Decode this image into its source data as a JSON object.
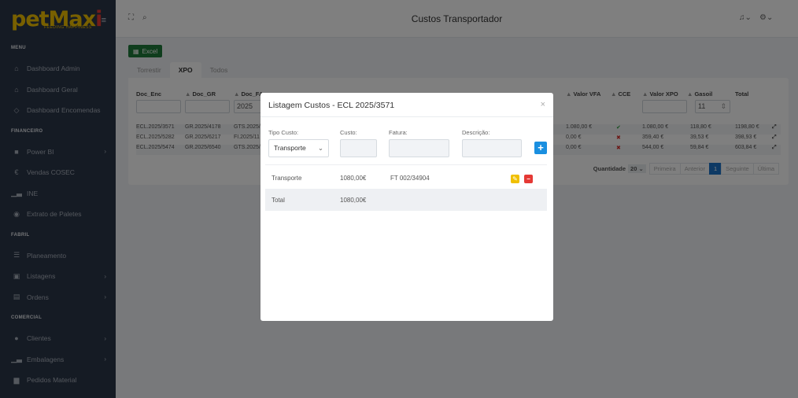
{
  "app": {
    "brand_main": "petMax",
    "brand_i": "i",
    "brand_tagline": "FEEDING HAPPINESS",
    "title": "Custos Transportador"
  },
  "sidebar": {
    "sections": [
      {
        "label": "MENU"
      },
      {
        "label": "FINANCEIRO"
      },
      {
        "label": "FABRIL"
      },
      {
        "label": "COMERCIAL"
      }
    ],
    "items": [
      {
        "label": "Dashboard Admin",
        "icon": "home-icon"
      },
      {
        "label": "Dashboard Geral",
        "icon": "home-icon"
      },
      {
        "label": "Dashboard Encomendas",
        "icon": "shield-icon"
      },
      {
        "label": "Power BI",
        "icon": "car-icon"
      },
      {
        "label": "Vendas COSEC",
        "icon": "euro-icon"
      },
      {
        "label": "INE",
        "icon": "chart-icon"
      },
      {
        "label": "Extrato de Paletes",
        "icon": "eye-icon"
      },
      {
        "label": "Planeamento",
        "icon": "list-icon"
      },
      {
        "label": "Listagens",
        "icon": "box-icon"
      },
      {
        "label": "Ordens",
        "icon": "file-icon"
      },
      {
        "label": "Clientes",
        "icon": "user-icon"
      },
      {
        "label": "Embalagens",
        "icon": "chart-icon"
      },
      {
        "label": "Pedidos Material",
        "icon": "truck-icon"
      }
    ]
  },
  "toolbar": {
    "excel_label": "Excel"
  },
  "tabs": [
    "Torrestir",
    "XPO",
    "Todos"
  ],
  "table": {
    "headers": [
      "Doc_Enc",
      "Doc_GR",
      "Doc_FA",
      "Valor VFA",
      "CCE",
      "Valor XPO",
      "Gasoil",
      "Total"
    ],
    "filter_year": "2025",
    "filter_gasoil": "11",
    "rows": [
      {
        "enc": "ECL.2025/3571",
        "gr": "GR.2025/4178",
        "fa": "GTS.2025/",
        "vfa": "1.080,00 €",
        "cce": "✔",
        "xpo": "1.080,00 €",
        "gasoil": "118,80 €",
        "total": "1198,80 €"
      },
      {
        "enc": "ECL.2025/5282",
        "gr": "GR.2025/6217",
        "fa": "FI.2025/11",
        "vfa": "0,00 €",
        "cce": "✖",
        "xpo": "359,40 €",
        "gasoil": "39,53 €",
        "total": "398,93 €"
      },
      {
        "enc": "ECL.2025/5474",
        "gr": "GR.2025/6540",
        "fa": "GTS.2025/",
        "vfa": "0,00 €",
        "cce": "✖",
        "xpo": "544,00 €",
        "gasoil": "59,84 €",
        "total": "603,84 €"
      }
    ]
  },
  "pagination": {
    "quantity_label": "Quantidade",
    "quantity_value": "20",
    "first": "Primeira",
    "previous": "Anterior",
    "current": "1",
    "next": "Seguinte",
    "last": "Última"
  },
  "modal": {
    "title": "Listagem Custos - ECL 2025/3571",
    "close": "×",
    "labels": {
      "tipo": "Tipo Custo:",
      "custo": "Custo:",
      "fatura": "Fatura:",
      "descricao": "Descrição:"
    },
    "tipo_value": "Transporte",
    "add_label": "+",
    "rows": [
      {
        "tipo": "Transporte",
        "custo": "1080,00€",
        "fatura": "FT 002/34904"
      }
    ],
    "total_label": "Total",
    "total_value": "1080,00€"
  },
  "colors": {
    "sidebar": "#2b3648",
    "brand": "#f0c000",
    "accent": "#1a8fe0",
    "excel": "#1f7a3a",
    "edit": "#f0c000",
    "delete": "#e53935"
  }
}
